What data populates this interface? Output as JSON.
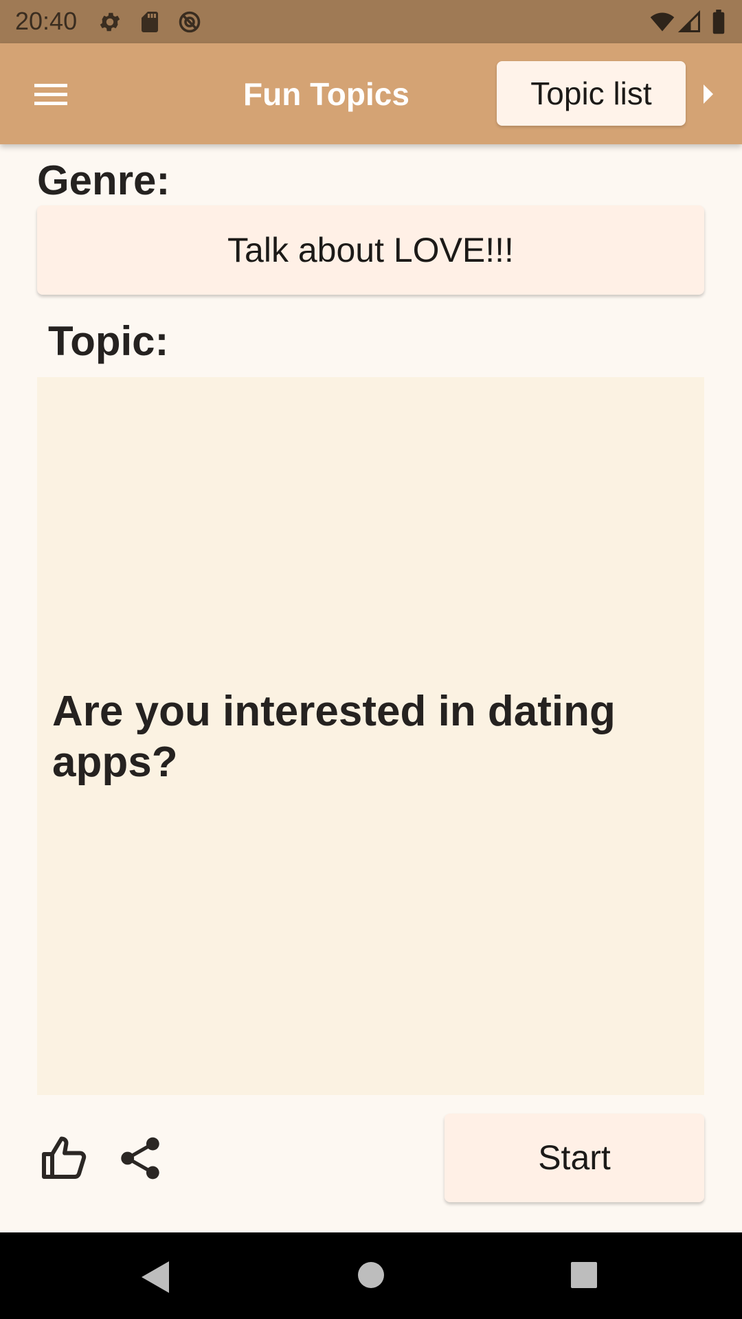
{
  "status_bar": {
    "time": "20:40",
    "icons": [
      "gear-icon",
      "sd-card-icon",
      "vpn-key-icon",
      "wifi-icon",
      "cell-signal-icon",
      "battery-icon"
    ]
  },
  "app_bar": {
    "menu_icon": "hamburger-menu-icon",
    "title": "Fun Topics",
    "topic_list_label": "Topic list",
    "overflow_icon": "caret-right-icon"
  },
  "genre": {
    "label": "Genre:",
    "value": "Talk about LOVE!!!"
  },
  "topic": {
    "label": "Topic:",
    "text": "Are you interested in dating apps?"
  },
  "actions": {
    "like_icon": "thumb-up-icon",
    "share_icon": "share-icon",
    "start_label": "Start"
  },
  "navigation": {
    "back_icon": "back-triangle-icon",
    "home_icon": "home-circle-icon",
    "recents_icon": "recents-square-icon"
  },
  "colors": {
    "status_bar": "#9f7a55",
    "app_bar": "#d4a374",
    "background": "#fdf8f2",
    "card": "#fbf2e2",
    "button": "#fff0e6"
  }
}
